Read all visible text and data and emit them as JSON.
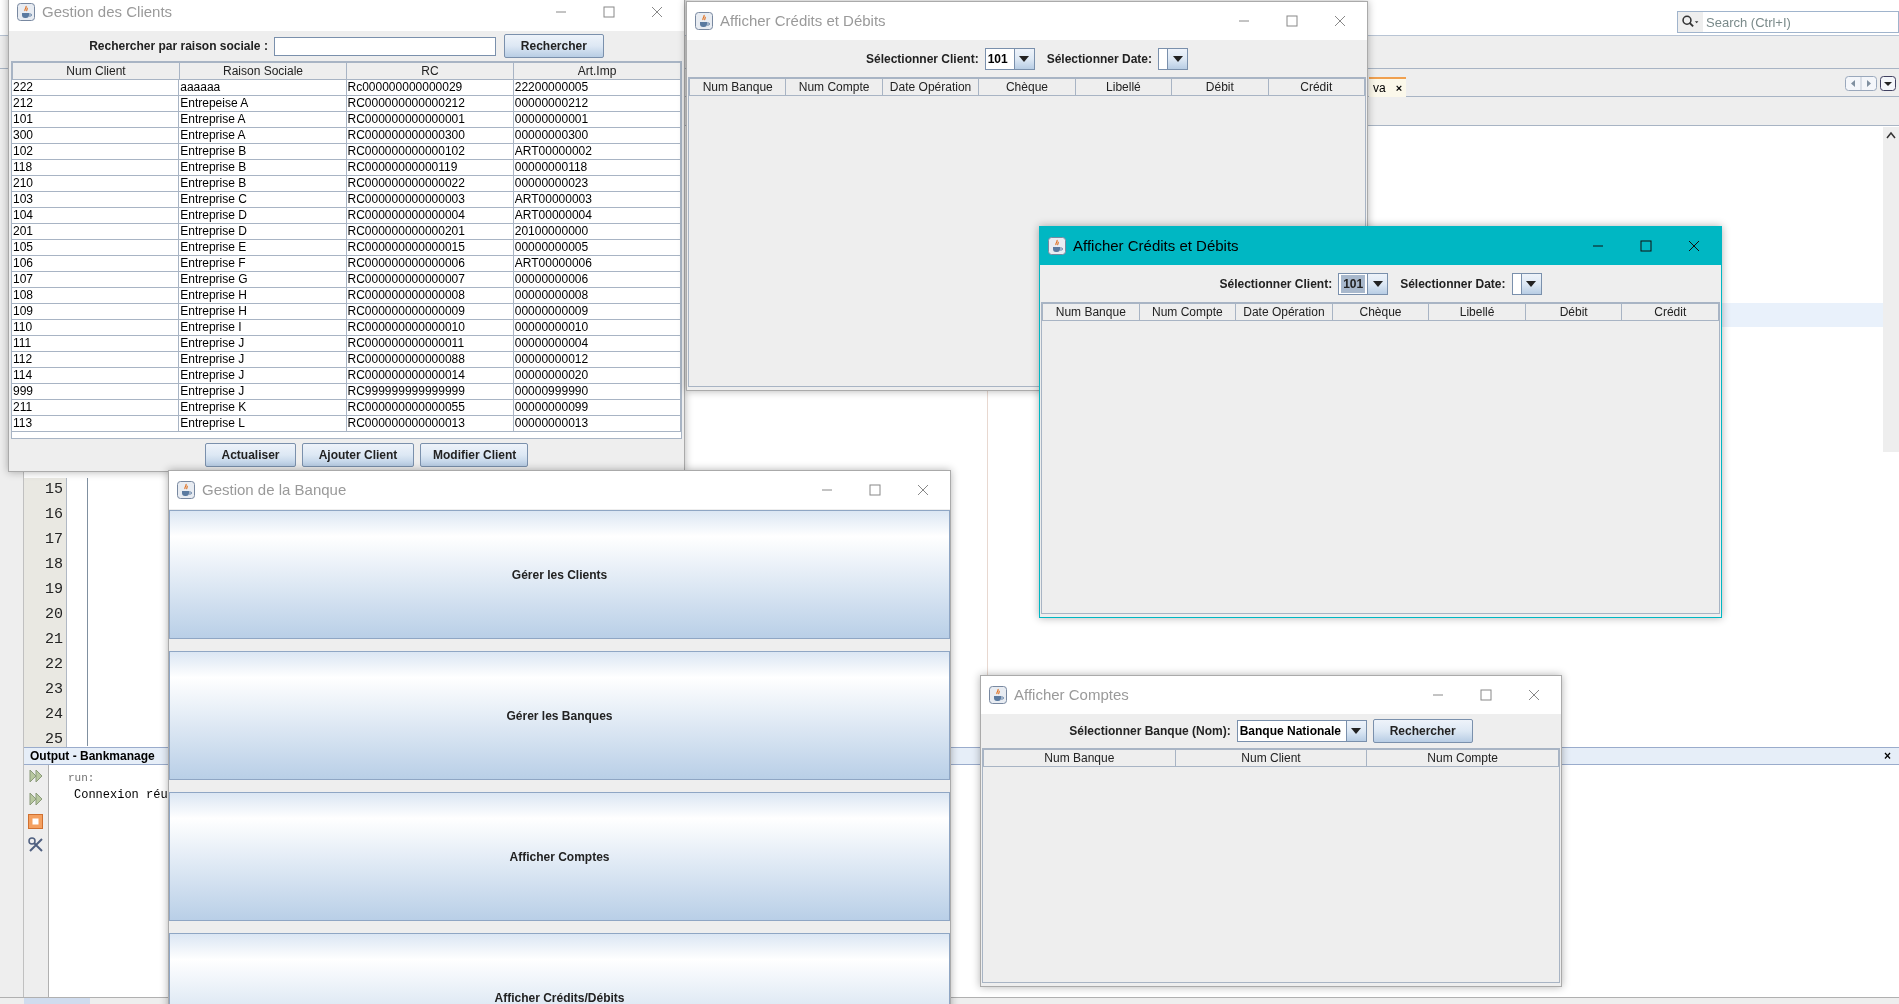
{
  "ide": {
    "search_placeholder": "Search (Ctrl+I)",
    "editor_tab": {
      "label": "va",
      "close": "×"
    },
    "line_numbers": [
      "15",
      "16",
      "17",
      "18",
      "19",
      "20",
      "21",
      "22",
      "23",
      "24",
      "25"
    ],
    "output": {
      "title": "Output - Bankmanage",
      "close": "×",
      "lines": [
        "run:",
        "Connexion réu"
      ]
    }
  },
  "windows": [
    {
      "kind": "clients",
      "title": "Gestion des Clients",
      "active": false,
      "search_label": "Rechercher par raison sociale :",
      "search_button": "Rechercher",
      "columns": [
        "Num Client",
        "Raison Sociale",
        "RC",
        "Art.Imp"
      ],
      "rows": [
        [
          "222",
          "aaaaaa",
          "Rc000000000000029",
          "22200000005"
        ],
        [
          "212",
          "Entrepeise A",
          "RC000000000000212",
          "00000000212"
        ],
        [
          "101",
          "Entreprise A",
          "RC000000000000001",
          "00000000001"
        ],
        [
          "300",
          "Entreprise A",
          "RC000000000000300",
          "00000000300"
        ],
        [
          "102",
          "Entreprise B",
          "RC000000000000102",
          "ART00000002"
        ],
        [
          "118",
          "Entreprise B",
          "RC00000000000119",
          "00000000118"
        ],
        [
          "210",
          "Entreprise B",
          "RC000000000000022",
          "00000000023"
        ],
        [
          "103",
          "Entreprise C",
          "RC000000000000003",
          "ART00000003"
        ],
        [
          "104",
          "Entreprise D",
          "RC000000000000004",
          "ART00000004"
        ],
        [
          "201",
          "Entreprise D",
          "RC000000000000201",
          "20100000000"
        ],
        [
          "105",
          "Entreprise E",
          "RC000000000000015",
          "00000000005"
        ],
        [
          "106",
          "Entreprise F",
          "RC000000000000006",
          "ART00000006"
        ],
        [
          "107",
          "Entreprise G",
          "RC000000000000007",
          "00000000006"
        ],
        [
          "108",
          "Entreprise H",
          "RC000000000000008",
          "00000000008"
        ],
        [
          "109",
          "Entreprise H",
          "RC000000000000009",
          "00000000009"
        ],
        [
          "110",
          "Entreprise I",
          "RC000000000000010",
          "00000000010"
        ],
        [
          "111",
          "Entreprise J",
          "RC000000000000011",
          "00000000004"
        ],
        [
          "112",
          "Entreprise J",
          "RC000000000000088",
          "00000000012"
        ],
        [
          "114",
          "Entreprise J",
          "RC000000000000014",
          "00000000020"
        ],
        [
          "999",
          "Entreprise J",
          "RC999999999999999",
          "00000999990"
        ],
        [
          "211",
          "Entreprise K",
          "RC000000000000055",
          "00000000099"
        ],
        [
          "113",
          "Entreprise L",
          "RC000000000000013",
          "00000000013"
        ]
      ],
      "buttons": [
        "Actualiser",
        "Ajouter Client",
        "Modifier Client"
      ]
    },
    {
      "kind": "credits",
      "title": "Afficher Crédits et Débits",
      "active": false,
      "client_label": "Sélectionner Client:",
      "client_combo": {
        "value": "101",
        "focused": false
      },
      "date_label": "Sélectionner Date:",
      "columns": [
        "Num Banque",
        "Num Compte",
        "Date Opération",
        "Chèque",
        "Libellé",
        "Débit",
        "Crédit"
      ]
    },
    {
      "kind": "banque",
      "title": "Gestion de la Banque",
      "active": false,
      "buttons": [
        "Gérer les Clients",
        "Gérer les Banques",
        "Afficher Comptes",
        "Afficher Crédits/Débits"
      ]
    },
    {
      "kind": "credits",
      "title": "Afficher Crédits et Débits",
      "active": true,
      "client_label": "Sélectionner Client:",
      "client_combo": {
        "value": "101",
        "focused": true
      },
      "date_label": "Sélectionner Date:",
      "columns": [
        "Num Banque",
        "Num Compte",
        "Date Opération",
        "Chèque",
        "Libellé",
        "Débit",
        "Crédit"
      ]
    },
    {
      "kind": "comptes",
      "title": "Afficher Comptes",
      "active": false,
      "bank_label": "Sélectionner Banque (Nom):",
      "bank_combo": "Banque Nationale",
      "search_button": "Rechercher",
      "columns": [
        "Num Banque",
        "Num Client",
        "Num Compte"
      ]
    }
  ]
}
